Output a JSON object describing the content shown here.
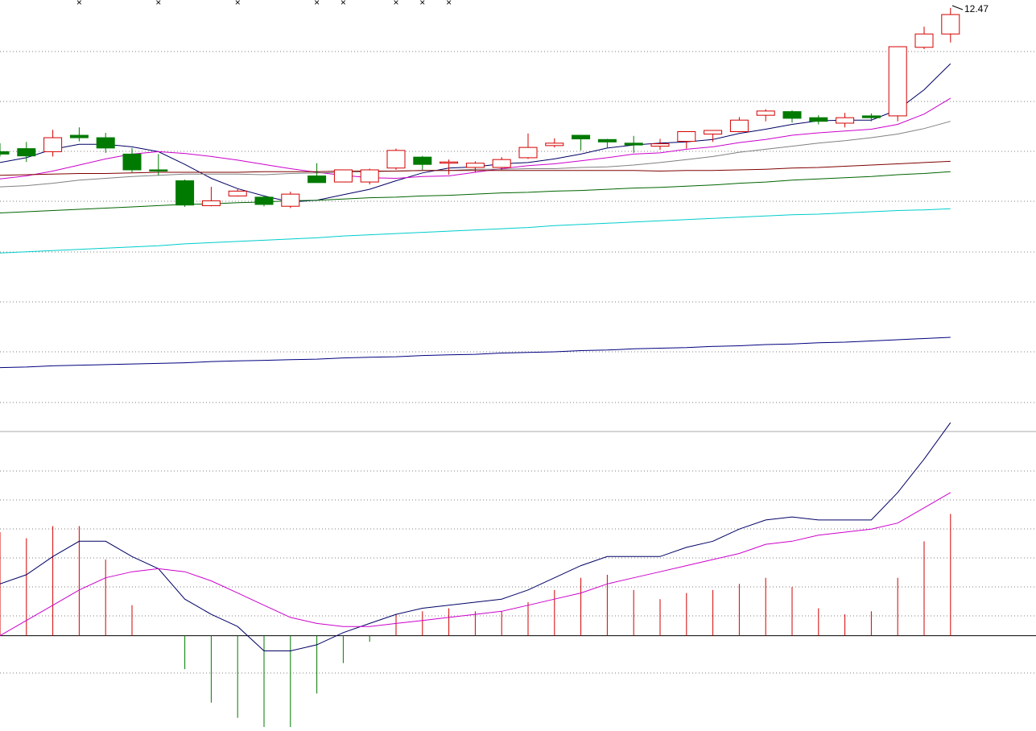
{
  "chart_data": [
    {
      "type": "candlestick",
      "panel": "price",
      "price_label": "12.47",
      "colors": {
        "up": "#d40000",
        "down": "#007a00"
      },
      "ylim": [
        5.5,
        12.6
      ],
      "candles": [
        {
          "o": 10.1,
          "h": 10.24,
          "l": 10.02,
          "c": 10.06
        },
        {
          "o": 10.15,
          "h": 10.26,
          "l": 9.93,
          "c": 10.03
        },
        {
          "o": 10.1,
          "h": 10.46,
          "l": 10.02,
          "c": 10.33
        },
        {
          "o": 10.37,
          "h": 10.5,
          "l": 10.27,
          "c": 10.33
        },
        {
          "o": 10.33,
          "h": 10.41,
          "l": 10.08,
          "c": 10.16
        },
        {
          "o": 10.06,
          "h": 10.16,
          "l": 9.76,
          "c": 9.8
        },
        {
          "o": 9.8,
          "h": 10.06,
          "l": 9.71,
          "c": 9.78
        },
        {
          "o": 9.62,
          "h": 9.64,
          "l": 9.19,
          "c": 9.22
        },
        {
          "o": 9.21,
          "h": 9.52,
          "l": 9.2,
          "c": 9.29
        },
        {
          "o": 9.37,
          "h": 9.48,
          "l": 9.36,
          "c": 9.45
        },
        {
          "o": 9.35,
          "h": 9.38,
          "l": 9.2,
          "c": 9.23
        },
        {
          "o": 9.2,
          "h": 9.44,
          "l": 9.17,
          "c": 9.4
        },
        {
          "o": 9.7,
          "h": 9.91,
          "l": 9.64,
          "c": 9.59
        },
        {
          "o": 9.6,
          "h": 9.8,
          "l": 9.6,
          "c": 9.8
        },
        {
          "o": 9.6,
          "h": 9.82,
          "l": 9.56,
          "c": 9.8
        },
        {
          "o": 9.83,
          "h": 10.15,
          "l": 9.8,
          "c": 10.12
        },
        {
          "o": 10.01,
          "h": 10.03,
          "l": 9.8,
          "c": 9.89
        },
        {
          "o": 9.91,
          "h": 9.97,
          "l": 9.72,
          "c": 9.93
        },
        {
          "o": 9.84,
          "h": 9.94,
          "l": 9.76,
          "c": 9.91
        },
        {
          "o": 9.84,
          "h": 10.01,
          "l": 9.8,
          "c": 9.97
        },
        {
          "o": 10.0,
          "h": 10.4,
          "l": 9.98,
          "c": 10.17
        },
        {
          "o": 10.2,
          "h": 10.32,
          "l": 10.17,
          "c": 10.24
        },
        {
          "o": 10.37,
          "h": 10.37,
          "l": 10.12,
          "c": 10.31
        },
        {
          "o": 10.3,
          "h": 10.31,
          "l": 10.16,
          "c": 10.26
        },
        {
          "o": 10.24,
          "h": 10.36,
          "l": 10.08,
          "c": 10.21
        },
        {
          "o": 10.19,
          "h": 10.31,
          "l": 10.13,
          "c": 10.23
        },
        {
          "o": 10.27,
          "h": 10.43,
          "l": 10.15,
          "c": 10.43
        },
        {
          "o": 10.39,
          "h": 10.45,
          "l": 10.26,
          "c": 10.45
        },
        {
          "o": 10.43,
          "h": 10.67,
          "l": 10.42,
          "c": 10.62
        },
        {
          "o": 10.7,
          "h": 10.8,
          "l": 10.6,
          "c": 10.77
        },
        {
          "o": 10.76,
          "h": 10.78,
          "l": 10.58,
          "c": 10.65
        },
        {
          "o": 10.66,
          "h": 10.7,
          "l": 10.55,
          "c": 10.6
        },
        {
          "o": 10.57,
          "h": 10.74,
          "l": 10.5,
          "c": 10.66
        },
        {
          "o": 10.69,
          "h": 10.73,
          "l": 10.6,
          "c": 10.66
        },
        {
          "o": 10.69,
          "h": 11.83,
          "l": 10.6,
          "c": 11.83
        },
        {
          "o": 11.82,
          "h": 12.16,
          "l": 11.79,
          "c": 12.04
        },
        {
          "o": 12.04,
          "h": 12.47,
          "l": 11.9,
          "c": 12.36
        }
      ],
      "ma_lines": [
        {
          "color": "#000066",
          "values": [
            9.92,
            10.0,
            10.14,
            10.22,
            10.22,
            10.18,
            10.1,
            9.89,
            9.66,
            9.49,
            9.37,
            9.27,
            9.3,
            9.39,
            9.48,
            9.62,
            9.75,
            9.83,
            9.85,
            9.9,
            9.92,
            9.98,
            10.06,
            10.16,
            10.21,
            10.24,
            10.26,
            10.3,
            10.4,
            10.47,
            10.55,
            10.61,
            10.62,
            10.62,
            10.79,
            11.12,
            11.55
          ]
        },
        {
          "color": "#cc00cc",
          "values": [
            9.65,
            9.7,
            9.78,
            9.88,
            9.98,
            10.06,
            10.1,
            10.07,
            10.02,
            9.96,
            9.89,
            9.82,
            9.76,
            9.71,
            9.67,
            9.66,
            9.69,
            9.7,
            9.76,
            9.82,
            9.87,
            9.9,
            9.95,
            10.0,
            10.06,
            10.08,
            10.14,
            10.18,
            10.25,
            10.3,
            10.37,
            10.41,
            10.44,
            10.47,
            10.55,
            10.72,
            10.98
          ]
        },
        {
          "color": "#808080",
          "values": [
            9.52,
            9.54,
            9.58,
            9.63,
            9.66,
            9.69,
            9.71,
            9.73,
            9.73,
            9.73,
            9.72,
            9.74,
            9.75,
            9.76,
            9.77,
            9.78,
            9.79,
            9.79,
            9.81,
            9.81,
            9.82,
            9.82,
            9.84,
            9.85,
            9.88,
            9.92,
            9.97,
            10.02,
            10.09,
            10.14,
            10.19,
            10.24,
            10.28,
            10.33,
            10.39,
            10.48,
            10.6
          ]
        },
        {
          "color": "#800000",
          "values": [
            9.71,
            9.72,
            9.73,
            9.74,
            9.74,
            9.75,
            9.76,
            9.76,
            9.76,
            9.76,
            9.77,
            9.77,
            9.77,
            9.78,
            9.78,
            9.78,
            9.79,
            9.79,
            9.79,
            9.79,
            9.79,
            9.79,
            9.79,
            9.79,
            9.79,
            9.78,
            9.79,
            9.79,
            9.8,
            9.81,
            9.83,
            9.84,
            9.86,
            9.88,
            9.9,
            9.92,
            9.94
          ]
        },
        {
          "color": "#006400",
          "values": [
            9.09,
            9.11,
            9.13,
            9.15,
            9.17,
            9.19,
            9.21,
            9.23,
            9.24,
            9.26,
            9.27,
            9.29,
            9.3,
            9.32,
            9.34,
            9.35,
            9.37,
            9.38,
            9.4,
            9.42,
            9.43,
            9.45,
            9.46,
            9.48,
            9.5,
            9.51,
            9.53,
            9.55,
            9.58,
            9.6,
            9.63,
            9.65,
            9.67,
            9.69,
            9.72,
            9.74,
            9.77
          ]
        },
        {
          "color": "#00cccc",
          "values": [
            8.43,
            8.45,
            8.47,
            8.49,
            8.51,
            8.53,
            8.55,
            8.58,
            8.6,
            8.62,
            8.64,
            8.66,
            8.68,
            8.71,
            8.73,
            8.75,
            8.77,
            8.79,
            8.81,
            8.83,
            8.85,
            8.88,
            8.9,
            8.92,
            8.94,
            8.96,
            8.98,
            9.0,
            9.02,
            9.04,
            9.06,
            9.07,
            9.09,
            9.11,
            9.13,
            9.14,
            9.16
          ]
        },
        {
          "color": "#000080",
          "values": [
            6.54,
            6.55,
            6.57,
            6.58,
            6.59,
            6.6,
            6.61,
            6.62,
            6.64,
            6.65,
            6.66,
            6.67,
            6.68,
            6.7,
            6.71,
            6.72,
            6.74,
            6.75,
            6.76,
            6.78,
            6.79,
            6.8,
            6.82,
            6.83,
            6.85,
            6.86,
            6.87,
            6.89,
            6.9,
            6.92,
            6.93,
            6.95,
            6.96,
            6.98,
            7.0,
            7.02,
            7.04
          ]
        }
      ],
      "signal_marks_candle_index": [
        3,
        6,
        9,
        12,
        13,
        15,
        16,
        17
      ]
    },
    {
      "type": "macd",
      "panel": "indicator",
      "ylim": [
        -0.3,
        0.66
      ],
      "colors": {
        "dif": "#000066",
        "dea": "#cc00cc",
        "hist_up": "#d40000",
        "hist_down": "#007a00"
      },
      "dif": [
        0.17,
        0.2,
        0.26,
        0.31,
        0.31,
        0.26,
        0.22,
        0.12,
        0.07,
        0.03,
        -0.05,
        -0.05,
        -0.03,
        0.01,
        0.04,
        0.07,
        0.09,
        0.1,
        0.11,
        0.12,
        0.15,
        0.19,
        0.23,
        0.26,
        0.26,
        0.26,
        0.29,
        0.31,
        0.35,
        0.38,
        0.39,
        0.38,
        0.38,
        0.38,
        0.47,
        0.58,
        0.7
      ],
      "dea": [
        0.0,
        0.05,
        0.1,
        0.15,
        0.19,
        0.21,
        0.22,
        0.21,
        0.18,
        0.14,
        0.1,
        0.06,
        0.04,
        0.03,
        0.03,
        0.04,
        0.05,
        0.06,
        0.07,
        0.08,
        0.1,
        0.12,
        0.14,
        0.17,
        0.19,
        0.21,
        0.23,
        0.25,
        0.27,
        0.3,
        0.31,
        0.33,
        0.34,
        0.35,
        0.37,
        0.42,
        0.47
      ],
      "histogram": [
        0.34,
        0.32,
        0.36,
        0.36,
        0.25,
        0.1,
        0.0,
        -0.11,
        -0.22,
        -0.27,
        -0.3,
        -0.3,
        -0.19,
        -0.09,
        -0.02,
        0.07,
        0.08,
        0.09,
        0.08,
        0.08,
        0.11,
        0.15,
        0.19,
        0.2,
        0.15,
        0.12,
        0.14,
        0.15,
        0.17,
        0.19,
        0.16,
        0.09,
        0.07,
        0.08,
        0.19,
        0.31,
        0.4
      ]
    }
  ]
}
